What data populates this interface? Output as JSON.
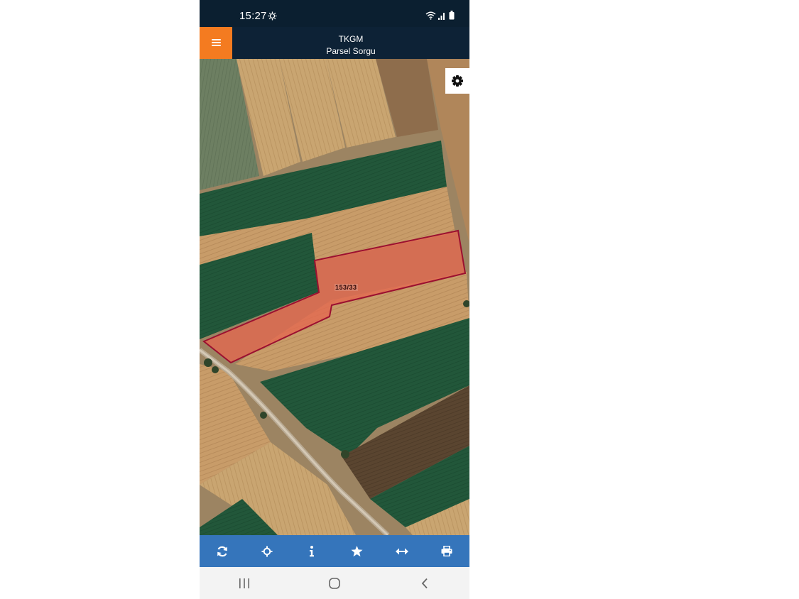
{
  "status_bar": {
    "time": "15:27",
    "icons": [
      "settings-sync-icon",
      "wifi-icon",
      "signal-icon",
      "battery-icon"
    ]
  },
  "app_bar": {
    "title": "TKGM",
    "subtitle": "Parsel Sorgu",
    "menu_icon": "hamburger-menu-icon"
  },
  "map": {
    "parcel_label": "153/33",
    "parcel_fill": "#e4684f",
    "parcel_outline": "#9b1030",
    "settings_icon": "gear-icon"
  },
  "toolbar": {
    "color": "#3575bb",
    "buttons": [
      {
        "name": "refresh-button",
        "icon": "refresh-icon"
      },
      {
        "name": "locate-button",
        "icon": "crosshair-icon"
      },
      {
        "name": "info-button",
        "icon": "info-icon"
      },
      {
        "name": "favorite-button",
        "icon": "star-icon"
      },
      {
        "name": "measure-button",
        "icon": "horizontal-arrows-icon"
      },
      {
        "name": "print-button",
        "icon": "printer-icon"
      }
    ]
  },
  "nav_bar": {
    "buttons": [
      "recent-apps-icon",
      "home-icon",
      "back-icon"
    ]
  },
  "colors": {
    "accent": "#f47b20",
    "header": "#0d2236",
    "toolbar": "#3575bb"
  }
}
